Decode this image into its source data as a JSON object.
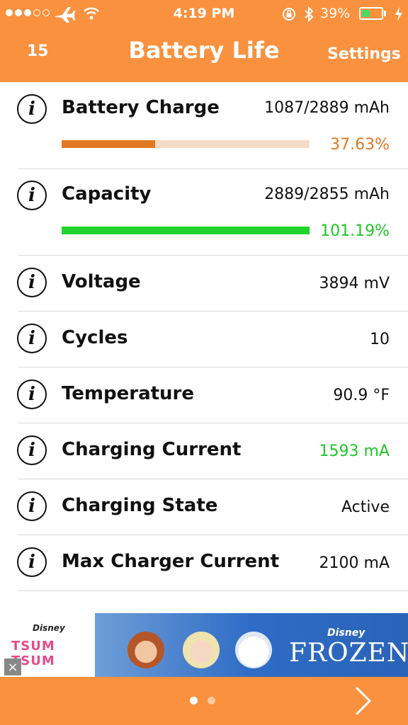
{
  "status_bar": {
    "time": "4:19 PM",
    "battery_percent": "39%",
    "signal_dots_filled": 3,
    "signal_dots_total": 5
  },
  "nav": {
    "left": "15",
    "title": "Battery Life",
    "right": "Settings"
  },
  "colors": {
    "header": "#f9913f",
    "charge_bar": "#e07823",
    "charge_track": "#f6dcc6",
    "capacity_bar": "#22d32c",
    "green_text": "#1fc72a",
    "orange_text": "#e07823"
  },
  "rows": [
    {
      "label": "Battery Charge",
      "value": "1087/2889 mAh",
      "percent": "37.63%",
      "fraction": 0.3763
    },
    {
      "label": "Capacity",
      "value": "2889/2855 mAh",
      "percent": "101.19%",
      "fraction": 1.0
    },
    {
      "label": "Voltage",
      "value": "3894 mV"
    },
    {
      "label": "Cycles",
      "value": "10"
    },
    {
      "label": "Temperature",
      "value": "90.9 °F"
    },
    {
      "label": "Charging Current",
      "value": "1593 mA"
    },
    {
      "label": "Charging State",
      "value": "Active"
    },
    {
      "label": "Max Charger Current",
      "value": "2100 mA"
    }
  ],
  "ad": {
    "left_brand": "Disney",
    "left_title": "TSUM TSUM",
    "right_brand": "Disney",
    "right_title": "FROZEN",
    "close": "×"
  },
  "pager": {
    "pages": 2,
    "current": 1
  }
}
